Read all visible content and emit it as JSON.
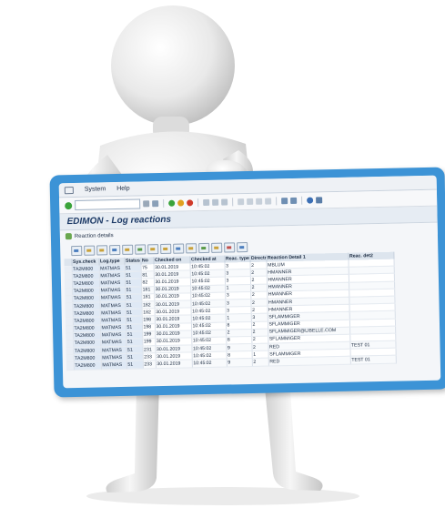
{
  "menu": {
    "items": [
      {
        "label": "System"
      },
      {
        "label": "Help"
      }
    ]
  },
  "command_field": {
    "value": ""
  },
  "title": "EDIMON - Log reactions",
  "app_toolbar": {
    "reaction_details_label": "Reaction details"
  },
  "table": {
    "headers": [
      "Sys.check",
      "Log.type",
      "Status",
      "No",
      "Checked on",
      "Checked at",
      "Reac. type",
      "Directn",
      "Reaction Detail 1",
      "Reac. det2"
    ],
    "rows": [
      [
        "TA2M800",
        "MATMAS",
        "51",
        "75",
        "30.01.2019",
        "10:45:02",
        "3",
        "2",
        "MBLUM",
        ""
      ],
      [
        "TA2M800",
        "MATMAS",
        "51",
        "81",
        "30.01.2019",
        "10:45:02",
        "3",
        "2",
        "HMANNER",
        ""
      ],
      [
        "TA2M800",
        "MATMAS",
        "51",
        "82",
        "30.01.2019",
        "10:45:02",
        "3",
        "2",
        "HMANNER",
        ""
      ],
      [
        "TA2M800",
        "MATMAS",
        "51",
        "181",
        "30.01.2019",
        "10:45:02",
        "1",
        "2",
        "HMANNER",
        ""
      ],
      [
        "TA2M800",
        "MATMAS",
        "51",
        "181",
        "30.01.2019",
        "10:45:02",
        "3",
        "2",
        "HMANNER",
        ""
      ],
      [
        "TA2M800",
        "MATMAS",
        "51",
        "182",
        "30.01.2019",
        "10:45:02",
        "3",
        "2",
        "HMANNER",
        ""
      ],
      [
        "TA2M800",
        "MATMAS",
        "51",
        "182",
        "30.01.2019",
        "10:45:02",
        "3",
        "2",
        "HMANNER",
        ""
      ],
      [
        "TA2M800",
        "MATMAS",
        "51",
        "198",
        "30.01.2019",
        "10:45:02",
        "1",
        "3",
        "SFLAMMIGER",
        ""
      ],
      [
        "TA2M800",
        "MATMAS",
        "51",
        "198",
        "30.01.2019",
        "10:45:02",
        "8",
        "2",
        "SFLAMMIGER",
        ""
      ],
      [
        "TA2M800",
        "MATMAS",
        "51",
        "199",
        "30.01.2019",
        "10:45:02",
        "2",
        "2",
        "SFLAMMIGER@LIBELLE.COM",
        ""
      ],
      [
        "TA2M800",
        "MATMAS",
        "51",
        "199",
        "30.01.2019",
        "10:45:02",
        "8",
        "2",
        "SFLAMMIGER",
        ""
      ],
      [
        "TA2M800",
        "MATMAS",
        "51",
        "231",
        "30.01.2019",
        "10:45:02",
        "9",
        "2",
        "RED",
        "TEST 01"
      ],
      [
        "TA2M800",
        "MATMAS",
        "51",
        "233",
        "30.01.2019",
        "10:45:02",
        "8",
        "1",
        "SFLAMMIGER",
        ""
      ],
      [
        "TA2M800",
        "MATMAS",
        "51",
        "233",
        "30.01.2019",
        "10:45:02",
        "9",
        "2",
        "RED",
        "TEST 01"
      ]
    ]
  },
  "colors": {
    "board_frame": "#3c93d6",
    "title_text": "#1d3a66",
    "key_cell": "#dfe9f5"
  }
}
